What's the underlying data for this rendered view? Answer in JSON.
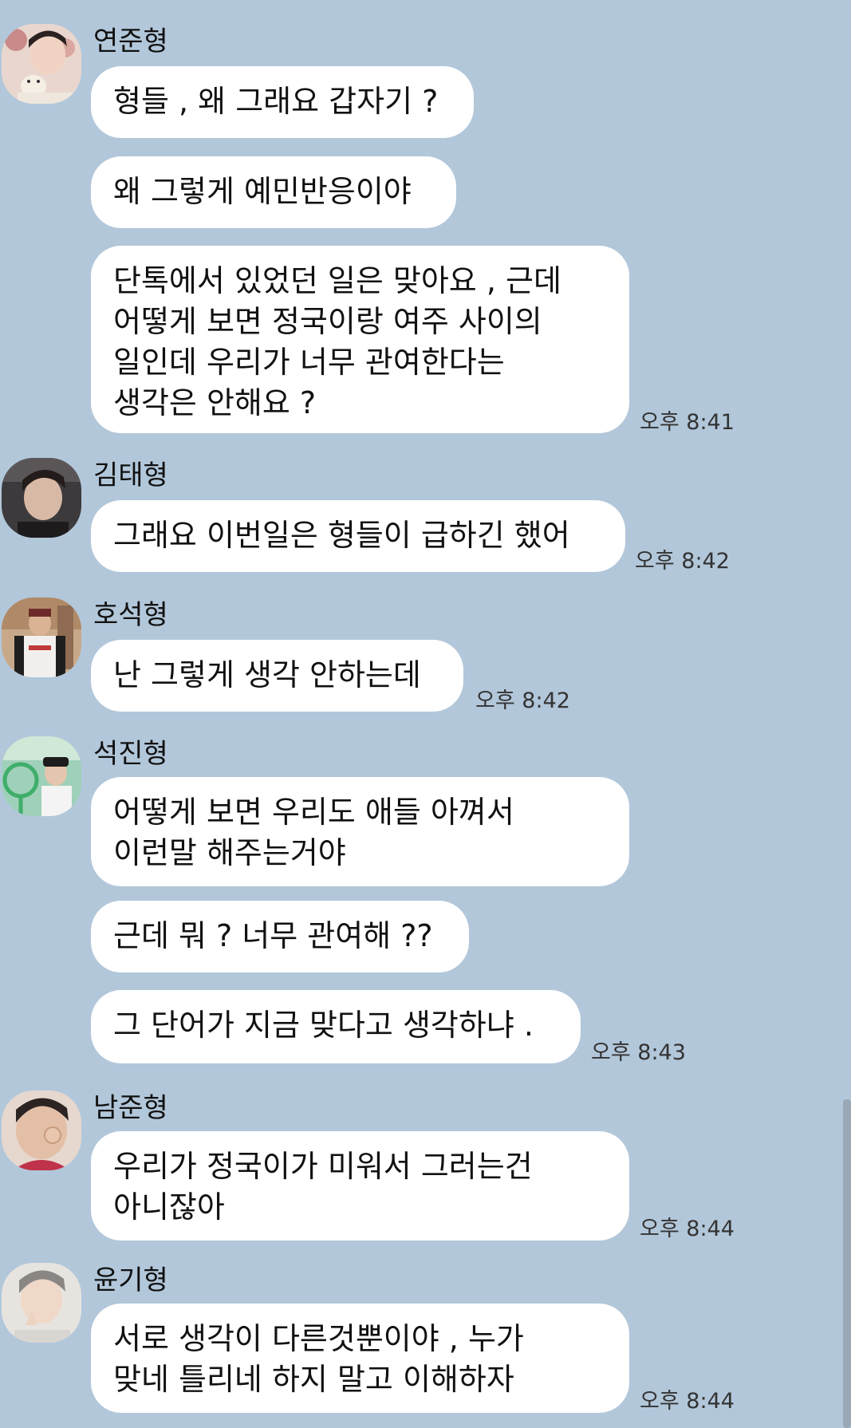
{
  "messages": [
    {
      "sender": "연준형",
      "avatar_icon": "profile-photo-yeonjun",
      "bubbles": [
        {
          "lines": [
            "형들 , 왜 그래요 갑자기 ?"
          ]
        },
        {
          "lines": [
            "왜 그렇게 예민반응이야"
          ]
        },
        {
          "lines": [
            "단톡에서 있었던 일은 맞아요 , 근데",
            "어떻게 보면 정국이랑 여주 사이의",
            "일인데 우리가 너무 관여한다는",
            "생각은 안해요 ?"
          ]
        }
      ],
      "time": "오후 8:41"
    },
    {
      "sender": "김태형",
      "avatar_icon": "profile-photo-taehyung",
      "bubbles": [
        {
          "lines": [
            "그래요 이번일은 형들이 급하긴 했어"
          ]
        }
      ],
      "time": "오후 8:42"
    },
    {
      "sender": "호석형",
      "avatar_icon": "profile-photo-hoseok",
      "bubbles": [
        {
          "lines": [
            "난 그렇게 생각 안하는데"
          ]
        }
      ],
      "time": "오후 8:42"
    },
    {
      "sender": "석진형",
      "avatar_icon": "profile-photo-seokjin",
      "bubbles": [
        {
          "lines": [
            "어떻게 보면 우리도 애들 아껴서",
            "이런말 해주는거야"
          ]
        },
        {
          "lines": [
            "근데 뭐 ? 너무 관여해 ??"
          ]
        },
        {
          "lines": [
            "그 단어가 지금 맞다고 생각하냐 ."
          ]
        }
      ],
      "time": "오후 8:43"
    },
    {
      "sender": "남준형",
      "avatar_icon": "profile-photo-namjoon",
      "bubbles": [
        {
          "lines": [
            "우리가 정국이가 미워서 그러는건",
            "아니잖아"
          ]
        }
      ],
      "time": "오후 8:44"
    },
    {
      "sender": "윤기형",
      "avatar_icon": "profile-photo-yoongi",
      "bubbles": [
        {
          "lines": [
            "서로 생각이 다른것뿐이야 , 누가",
            "맞네 틀리네 하지 말고 이해하자"
          ]
        }
      ],
      "time": "오후 8:44"
    }
  ],
  "colors": {
    "background": "#b2c7da",
    "bubble": "#ffffff",
    "text": "#111111",
    "time": "#333333"
  }
}
